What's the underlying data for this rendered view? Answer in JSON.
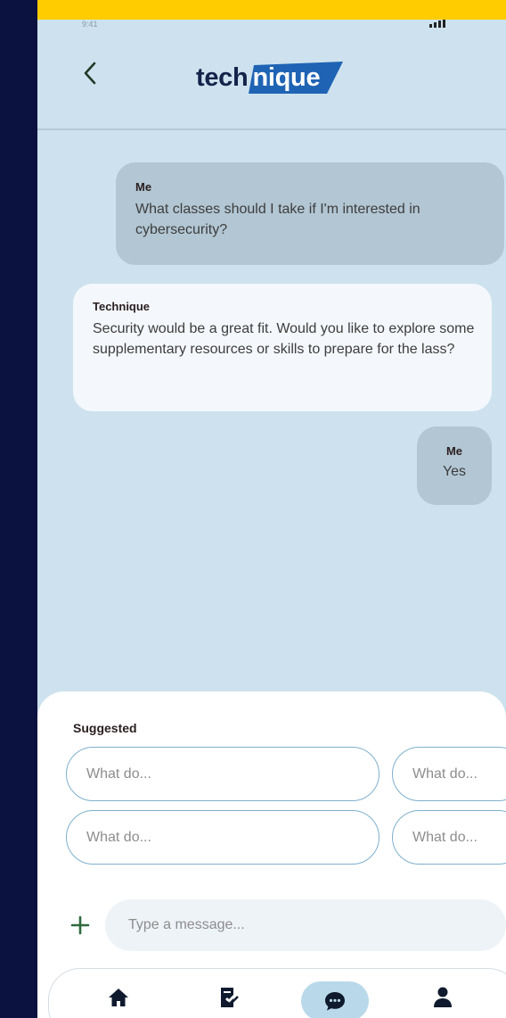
{
  "status_bar": {
    "time": "9:41"
  },
  "header": {
    "back_icon": "chevron-left-icon",
    "logo_part1": "tech",
    "logo_part2": "nique"
  },
  "messages": [
    {
      "sender": "Me",
      "text": "What classes should I take if I'm interested in cybersecurity?"
    },
    {
      "sender": "Technique",
      "text": "Security would be a great fit. Would you like to explore some supplementary resources or skills to prepare for the lass?"
    },
    {
      "sender": "Me",
      "text": "Yes"
    }
  ],
  "suggested": {
    "label": "Suggested",
    "chips": [
      "What do...",
      "What do...",
      "What do...",
      "What do..."
    ]
  },
  "composer": {
    "plus_icon": "plus-icon",
    "placeholder": "Type a message..."
  },
  "nav": {
    "items": [
      "home-icon",
      "tasks-icon",
      "chat-icon",
      "profile-icon"
    ],
    "active": "chat-icon"
  },
  "colors": {
    "background": "#cde2ee",
    "outer": "#0c1240",
    "top_strip": "#ffcc00",
    "my_bubble": "#b2c6d3",
    "bot_bubble": "#f4f8fc",
    "brand_dark": "#13234a",
    "brand_blue": "#1f63b4",
    "chip_border": "#7fb0cc",
    "active_nav": "#b9d9ea"
  }
}
